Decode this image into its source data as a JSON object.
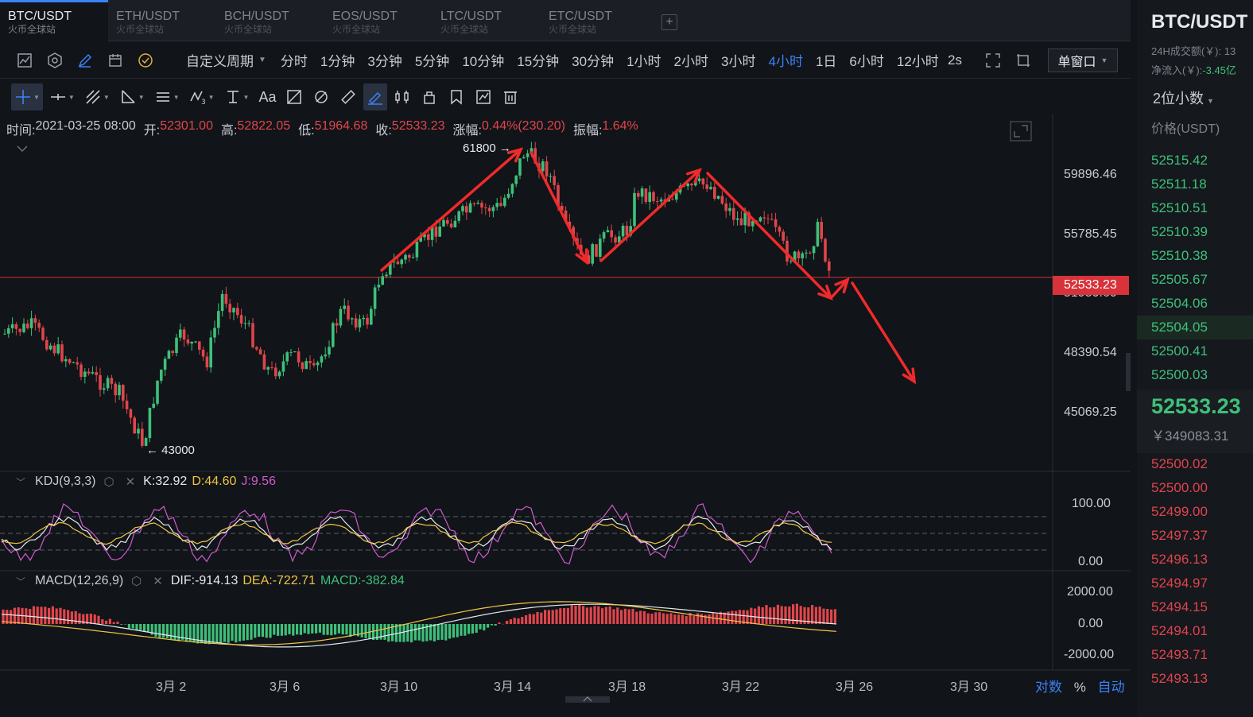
{
  "tabs": [
    {
      "pair": "BTC/USDT",
      "sub": "火币全球站"
    },
    {
      "pair": "ETH/USDT",
      "sub": "火币全球站"
    },
    {
      "pair": "BCH/USDT",
      "sub": "火币全球站"
    },
    {
      "pair": "EOS/USDT",
      "sub": "火币全球站"
    },
    {
      "pair": "LTC/USDT",
      "sub": "火币全球站"
    },
    {
      "pair": "ETC/USDT",
      "sub": "火币全球站"
    }
  ],
  "toolbar": {
    "add_tab": "+",
    "custom_period": "自定义周期",
    "intervals": [
      "分时",
      "1分钟",
      "3分钟",
      "5分钟",
      "10分钟",
      "15分钟",
      "30分钟",
      "1小时",
      "2小时",
      "3小时",
      "4小时",
      "1日",
      "6小时",
      "12小时"
    ],
    "active_interval": "4小时",
    "speed": "2s",
    "window_mode": "单窗口",
    "text_tool": "Aa"
  },
  "ohlc": {
    "time_label": "时间:",
    "time": "2021-03-25 08:00",
    "open_label": "开:",
    "open": "52301.00",
    "high_label": "高:",
    "high": "52822.05",
    "low_label": "低:",
    "low": "51964.68",
    "close_label": "收:",
    "close": "52533.23",
    "change_label": "涨幅:",
    "change": "0.44%(230.20)",
    "amp_label": "振幅:",
    "amp": "1.64%"
  },
  "price_axis": [
    "59896.46",
    "55785.45",
    "51950.60",
    "48390.54",
    "45069.25"
  ],
  "current_price_tag": "52533.23",
  "annotations": {
    "high": "61800",
    "low": "43000"
  },
  "kdj": {
    "name": "KDJ(9,3,3)",
    "k": "K:32.92",
    "d": "D:44.60",
    "j": "J:9.56",
    "axis": [
      "100.00",
      "0.00"
    ]
  },
  "macd": {
    "name": "MACD(12,26,9)",
    "dif": "DIF:-914.13",
    "dea": "DEA:-722.71",
    "macd": "MACD:-382.84",
    "axis": [
      "2000.00",
      "0.00",
      "-2000.00"
    ]
  },
  "x_axis": [
    "3月 2",
    "3月 6",
    "3月 10",
    "3月 14",
    "3月 18",
    "3月 22",
    "3月 26",
    "3月 30"
  ],
  "axis_options": {
    "log": "对数",
    "percent": "%",
    "auto": "自动"
  },
  "sidebar": {
    "title": "BTC/USDT",
    "vol_label": "24H成交额(￥): 13",
    "inflow_label": "净流入(￥):",
    "inflow_value": "-3.45亿",
    "decimals": "2位小数",
    "price_header": "价格(USDT)",
    "asks": [
      "52515.42",
      "52511.18",
      "52510.51",
      "52510.39",
      "52510.38",
      "52505.67",
      "52504.06",
      "52504.05",
      "52500.41",
      "52500.03"
    ],
    "last_price": "52533.23",
    "last_cny": "￥349083.31",
    "bids": [
      "52500.02",
      "52500.00",
      "52499.00",
      "52497.37",
      "52496.13",
      "52494.97",
      "52494.15",
      "52494.01",
      "52493.71",
      "52493.13"
    ]
  },
  "colors": {
    "up": "#3ec07a",
    "down": "#e0454c",
    "accent": "#3b82f6",
    "k": "#e6e9ee",
    "d": "#f0c545",
    "j": "#d05ad0"
  }
}
